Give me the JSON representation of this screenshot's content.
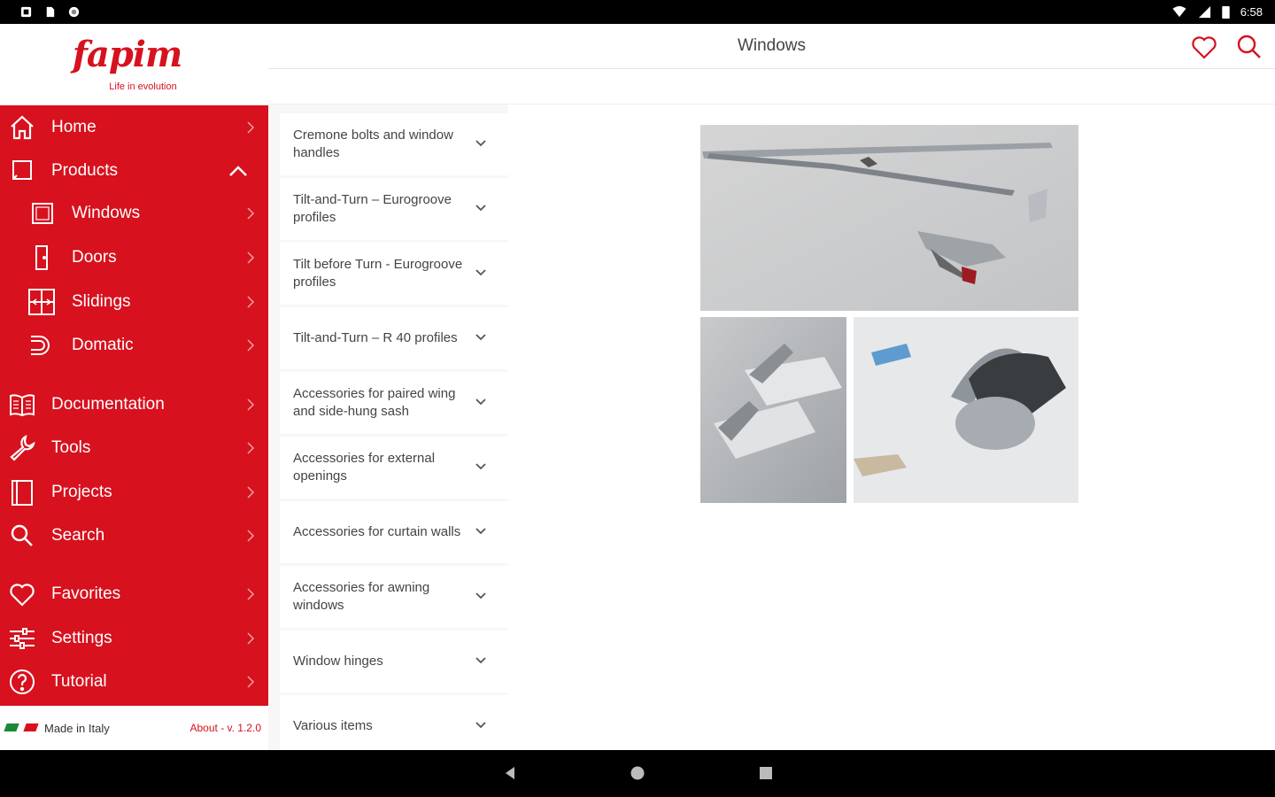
{
  "status_bar": {
    "time": "6:58"
  },
  "brand": {
    "logo": "fapim",
    "tagline": "Life in evolution"
  },
  "header": {
    "title": "Windows"
  },
  "sidebar": {
    "items": [
      {
        "label": "Home",
        "icon": "home-icon"
      },
      {
        "label": "Products",
        "icon": "square-icon"
      },
      {
        "label": "Windows",
        "icon": "window-icon"
      },
      {
        "label": "Doors",
        "icon": "door-icon"
      },
      {
        "label": "Slidings",
        "icon": "sliding-icon"
      },
      {
        "label": "Domatic",
        "icon": "domatic-icon"
      },
      {
        "label": "Documentation",
        "icon": "book-icon"
      },
      {
        "label": "Tools",
        "icon": "wrench-icon"
      },
      {
        "label": "Projects",
        "icon": "notebook-icon"
      },
      {
        "label": "Search",
        "icon": "search-icon"
      },
      {
        "label": "Favorites",
        "icon": "heart-icon"
      },
      {
        "label": "Settings",
        "icon": "sliders-icon"
      },
      {
        "label": "Tutorial",
        "icon": "help-icon"
      }
    ],
    "footer": {
      "made_in": "Made in Italy",
      "about": "About - v. 1.2.0"
    }
  },
  "categories": [
    "Cremone bolts and window handles",
    "Tilt-and-Turn – Eurogroove profiles",
    "Tilt before Turn - Eurogroove profiles",
    "Tilt-and-Turn – R 40 profiles",
    "Accessories for paired wing and side-hung sash",
    "Accessories for external openings",
    "Accessories for curtain walls",
    "Accessories for awning windows",
    "Window hinges",
    "Various items"
  ],
  "colors": {
    "brand_red": "#d7111e",
    "background": "#ffffff",
    "list_bg": "#f7f7f7"
  }
}
